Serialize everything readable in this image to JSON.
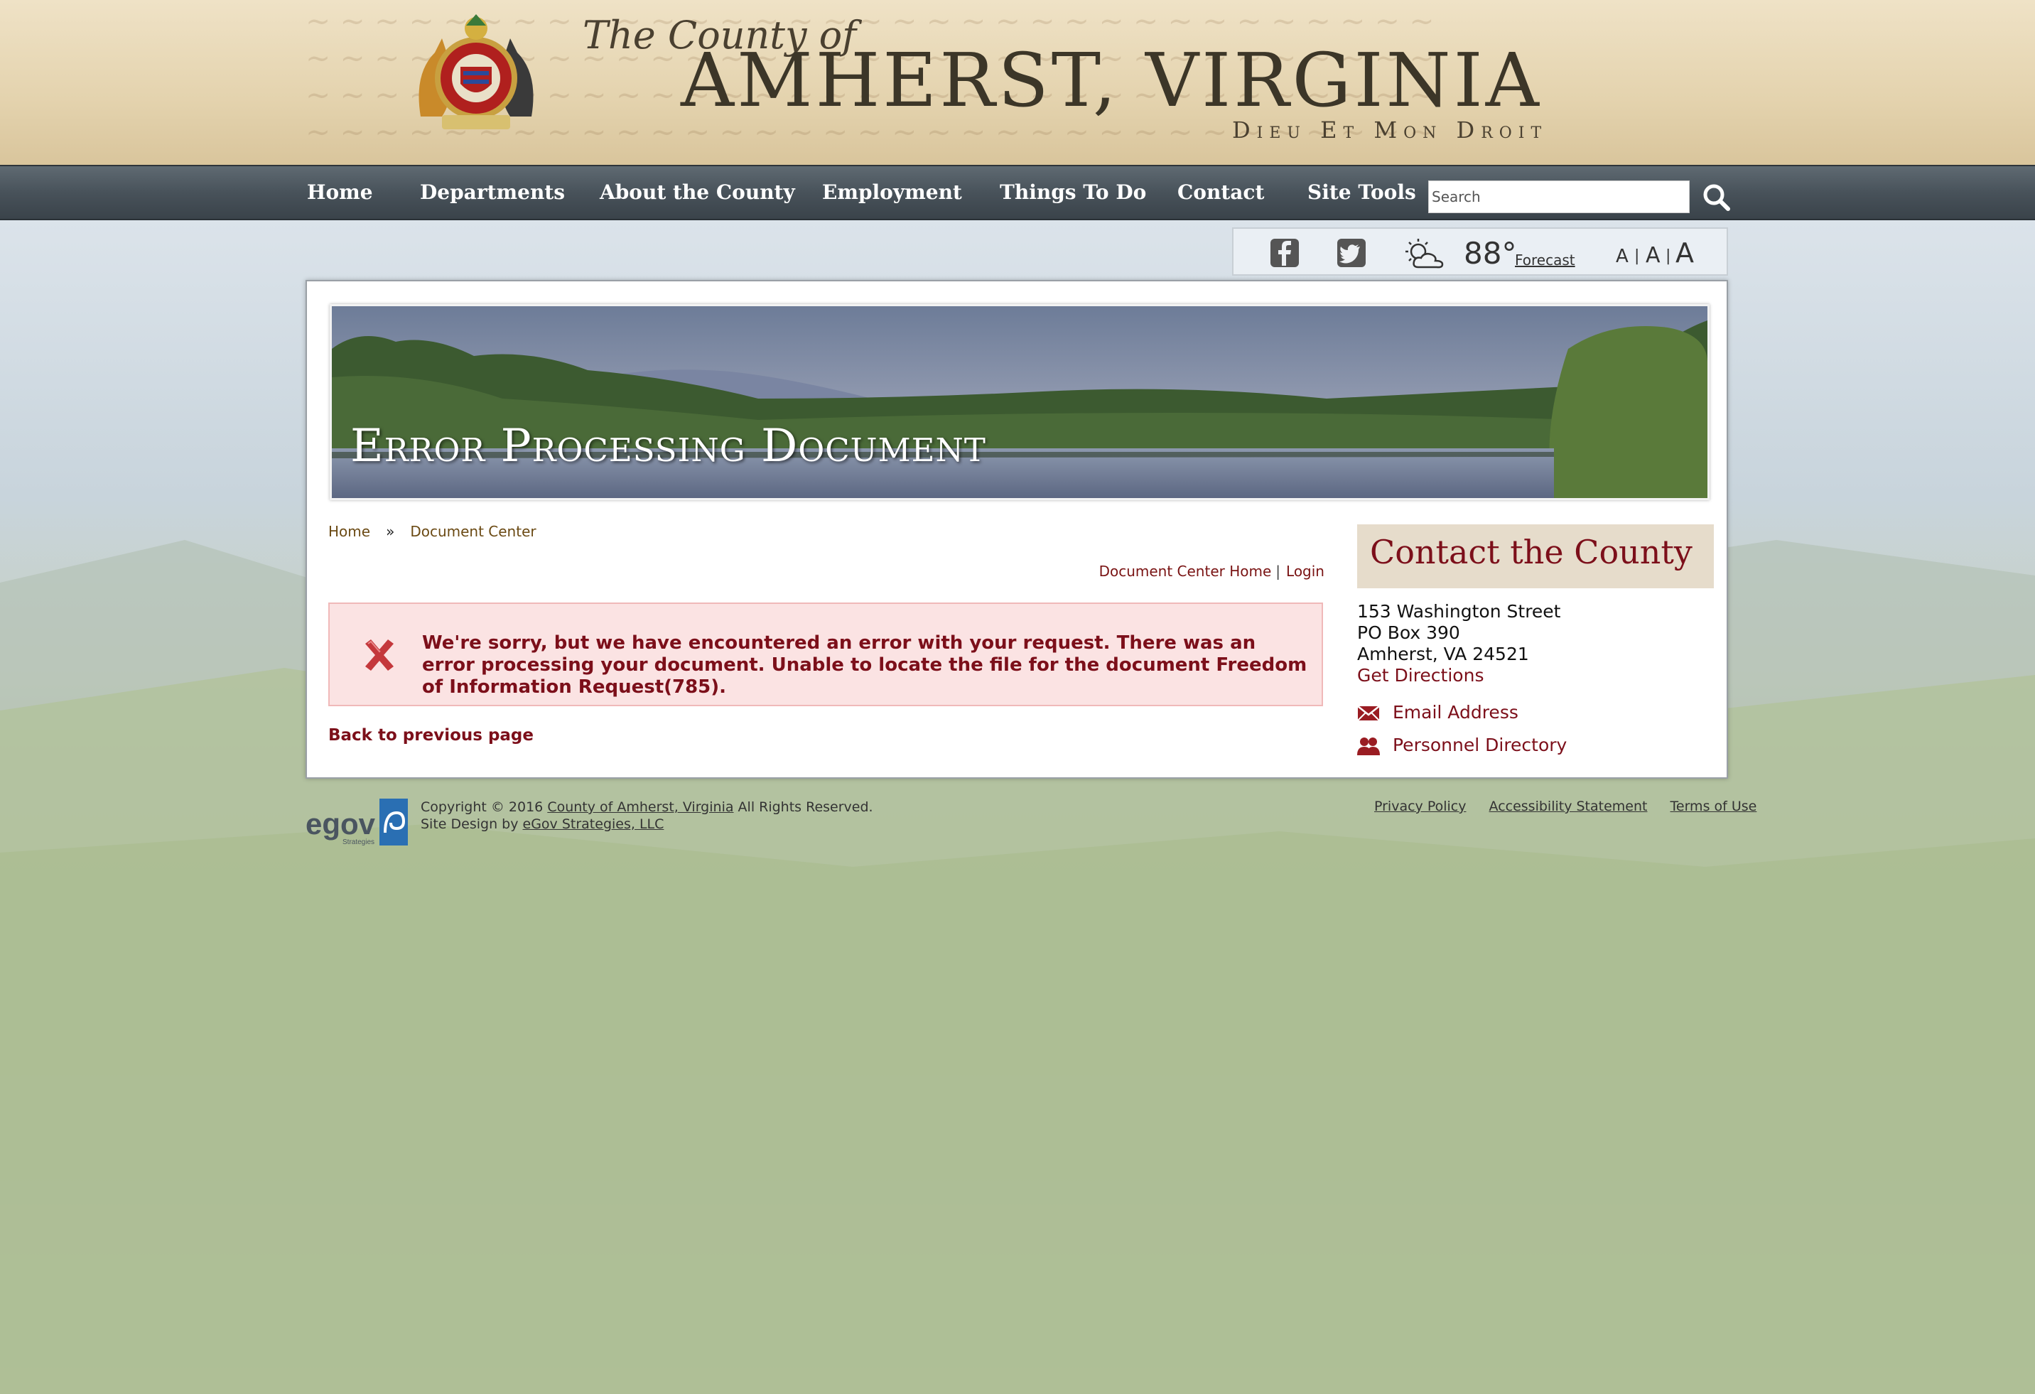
{
  "header": {
    "brand_prefix": "The County of",
    "brand_name": "AMHERST, VIRGINIA",
    "motto": "Dieu Et Mon Droit"
  },
  "nav": {
    "items": [
      {
        "label": "Home"
      },
      {
        "label": "Departments"
      },
      {
        "label": "About the County"
      },
      {
        "label": "Employment"
      },
      {
        "label": "Things To Do"
      },
      {
        "label": "Contact"
      },
      {
        "label": "Site Tools"
      }
    ],
    "search_placeholder": "Search"
  },
  "utility": {
    "temperature": "88°",
    "forecast_label": "Forecast",
    "font_sizes": [
      "A",
      "A",
      "A"
    ],
    "icons": [
      "facebook-icon",
      "twitter-icon",
      "partly-cloudy-icon"
    ]
  },
  "banner": {
    "title": "Error Processing Document"
  },
  "breadcrumb": {
    "items": [
      "Home",
      "Document Center"
    ],
    "separator": "»"
  },
  "doc_links": {
    "home": "Document Center Home",
    "separator": "|",
    "login": "Login"
  },
  "error": {
    "message": "We're sorry, but we have encountered an error with your request. There was an error processing your document. Unable to locate the file for the document Freedom of Information Request(785)."
  },
  "back_link": "Back to previous page",
  "contact": {
    "title": "Contact the County",
    "address_lines": [
      "153 Washington Street",
      "PO Box 390",
      "Amherst, VA 24521"
    ],
    "directions_label": "Get Directions",
    "email_label": "Email Address",
    "directory_label": "Personnel Directory"
  },
  "footer": {
    "copyright_prefix": "Copyright © 2016 ",
    "copyright_link": "County of Amherst, Virginia",
    "copyright_suffix": " All Rights Reserved.",
    "design_prefix": "Site Design by ",
    "design_link": "eGov Strategies, LLC",
    "links": [
      "Privacy Policy",
      "Accessibility Statement",
      "Terms of Use"
    ],
    "logo_text": "egov",
    "logo_sub": "Strategies"
  },
  "colors": {
    "accent": "#7c0f1a",
    "nav_bg": "#48525a",
    "header_bg": "#e4d3ae",
    "error_bg": "#fbe3e3",
    "sidebar_box": "#e6dccb"
  }
}
